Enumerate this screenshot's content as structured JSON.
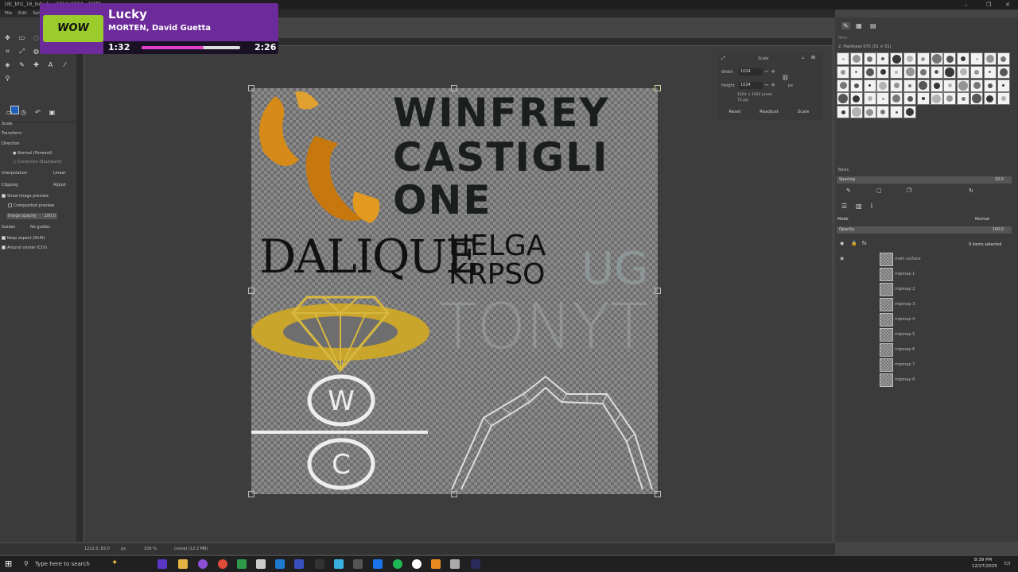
{
  "window": {
    "title": "[dc_bh1_16_lod...] ... 1024x1024 – GIMP",
    "min": "–",
    "max": "❐",
    "close": "✕"
  },
  "menubar": [
    "File",
    "Edit",
    "Select"
  ],
  "tool_options": {
    "heading": "Scale",
    "transform_label": "Transform:",
    "direction_label": "Direction",
    "direction_normal": "Normal (Forward)",
    "direction_corrective": "Corrective (Backward)",
    "interpolation_label": "Interpolation",
    "interpolation_value": "Linear",
    "clipping_label": "Clipping",
    "clipping_value": "Adjust",
    "show_preview": "Show image preview",
    "composited_preview": "Composited preview",
    "image_opacity_label": "Image opacity",
    "image_opacity_value": "100.0",
    "guides_label": "Guides",
    "guides_value": "No guides",
    "keep_aspect": "Keep aspect (Shift)",
    "around_center": "Around center (Ctrl)"
  },
  "canvas_text": {
    "line1": "WINFREY",
    "line2": "CASTIGLI",
    "line3": "ONE",
    "dalique": "DALIQUE",
    "helga": "HELGA",
    "krpso": "KRPSO",
    "ug": "UG",
    "tonyt": "TONYT"
  },
  "scale_dialog": {
    "title": "Scale",
    "width_label": "Width",
    "width_value": "1024",
    "height_label": "Height",
    "height_value": "1024",
    "unit": "px",
    "info_size": "1024 × 1024 pixels",
    "info_ppi": "72 ppi",
    "reset": "Reset",
    "readjust": "Readjust",
    "scale": "Scale"
  },
  "brushes": {
    "filter_placeholder": "filter",
    "current": "2. Hardness 075 (51 × 51)",
    "preset": "Basic,",
    "spacing_label": "Spacing",
    "spacing_value": "10.0"
  },
  "layers": {
    "mode_label": "Mode",
    "mode_value": "Normal",
    "opacity_label": "Opacity",
    "opacity_value": "100.0",
    "selected_count": "9 items selected",
    "items": [
      "main surface",
      "mipmap 1",
      "mipmap 2",
      "mipmap 3",
      "mipmap 4",
      "mipmap 5",
      "mipmap 6",
      "mipmap 7",
      "mipmap 8"
    ]
  },
  "statusbar": {
    "coords": "1222.0, 83.0",
    "unit": "px",
    "zoom": "100 %",
    "info": "(none) (12.2 MB)"
  },
  "taskbar": {
    "search": "Type here to search",
    "time": "8:39 PM",
    "date": "12/27/2025"
  },
  "now_playing": {
    "song": "Lucky",
    "artist": "MORTEN, David Guetta",
    "elapsed": "1:32",
    "duration": "2:26",
    "progress_fraction": 0.63,
    "art_text": "WOW"
  },
  "colors": {
    "accent_fg": "#1f5fb8",
    "overlay_purple": "#6c2a9a",
    "progress_pink": "#e040c8"
  }
}
